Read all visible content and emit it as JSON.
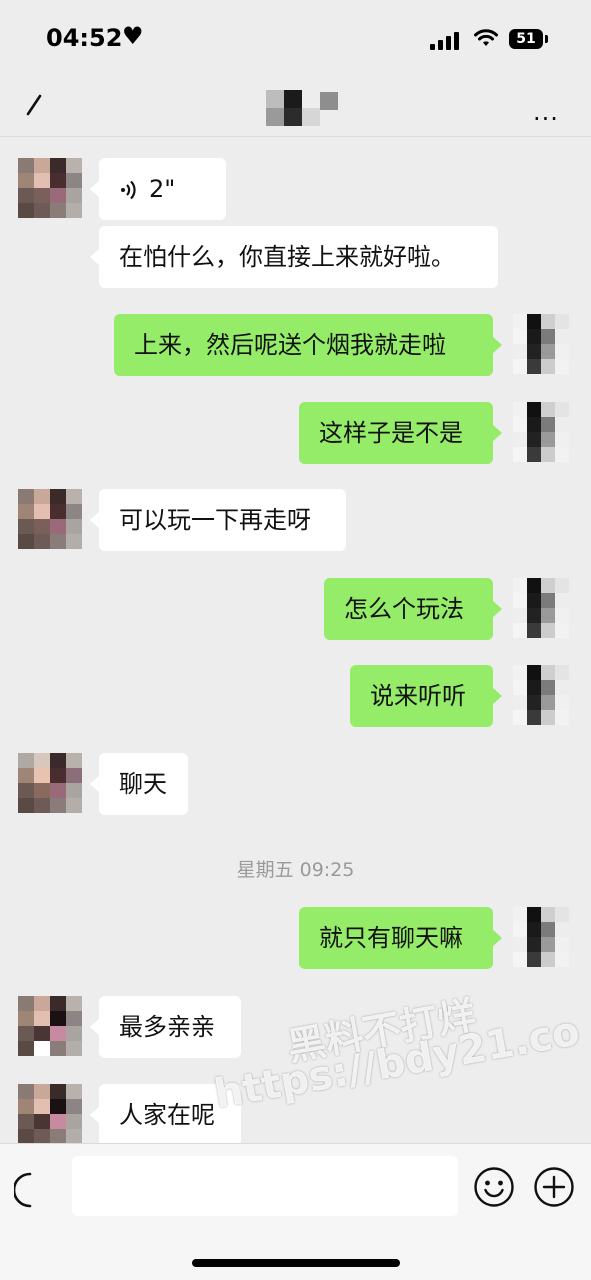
{
  "status_bar": {
    "time": "04:52",
    "heart": "♥",
    "battery": "51"
  },
  "nav": {
    "back_icon": "back-arrow-icon",
    "more_icon": "more-dots-icon",
    "more_text": "..."
  },
  "messages": [
    {
      "side": "in",
      "type": "voice",
      "duration": "2\""
    },
    {
      "side": "in",
      "type": "text",
      "text": "在怕什么，你直接上来就好啦。"
    },
    {
      "side": "out",
      "type": "text",
      "text": "上来，然后呢送个烟我就走啦"
    },
    {
      "side": "out",
      "type": "text",
      "text": "这样子是不是"
    },
    {
      "side": "in",
      "type": "text",
      "text": "可以玩一下再走呀"
    },
    {
      "side": "out",
      "type": "text",
      "text": "怎么个玩法"
    },
    {
      "side": "out",
      "type": "text",
      "text": "说来听听"
    },
    {
      "side": "in",
      "type": "text",
      "text": "聊天"
    },
    {
      "side": "out",
      "type": "text",
      "text": "就只有聊天嘛"
    },
    {
      "side": "in",
      "type": "text",
      "text": "最多亲亲"
    },
    {
      "side": "in",
      "type": "text",
      "text": "人家在呢"
    }
  ],
  "timestamp": "星期五 09:25",
  "watermark": {
    "line1": "黑料不打烊",
    "line2": "https://bdy21.co"
  },
  "input_bar": {
    "placeholder": "",
    "voice_icon": "voice-input-icon",
    "emoji_icon": "emoji-icon",
    "plus_icon": "plus-icon"
  },
  "colors": {
    "background": "#ededed",
    "bubble_in": "#ffffff",
    "bubble_out": "#95ec69"
  }
}
